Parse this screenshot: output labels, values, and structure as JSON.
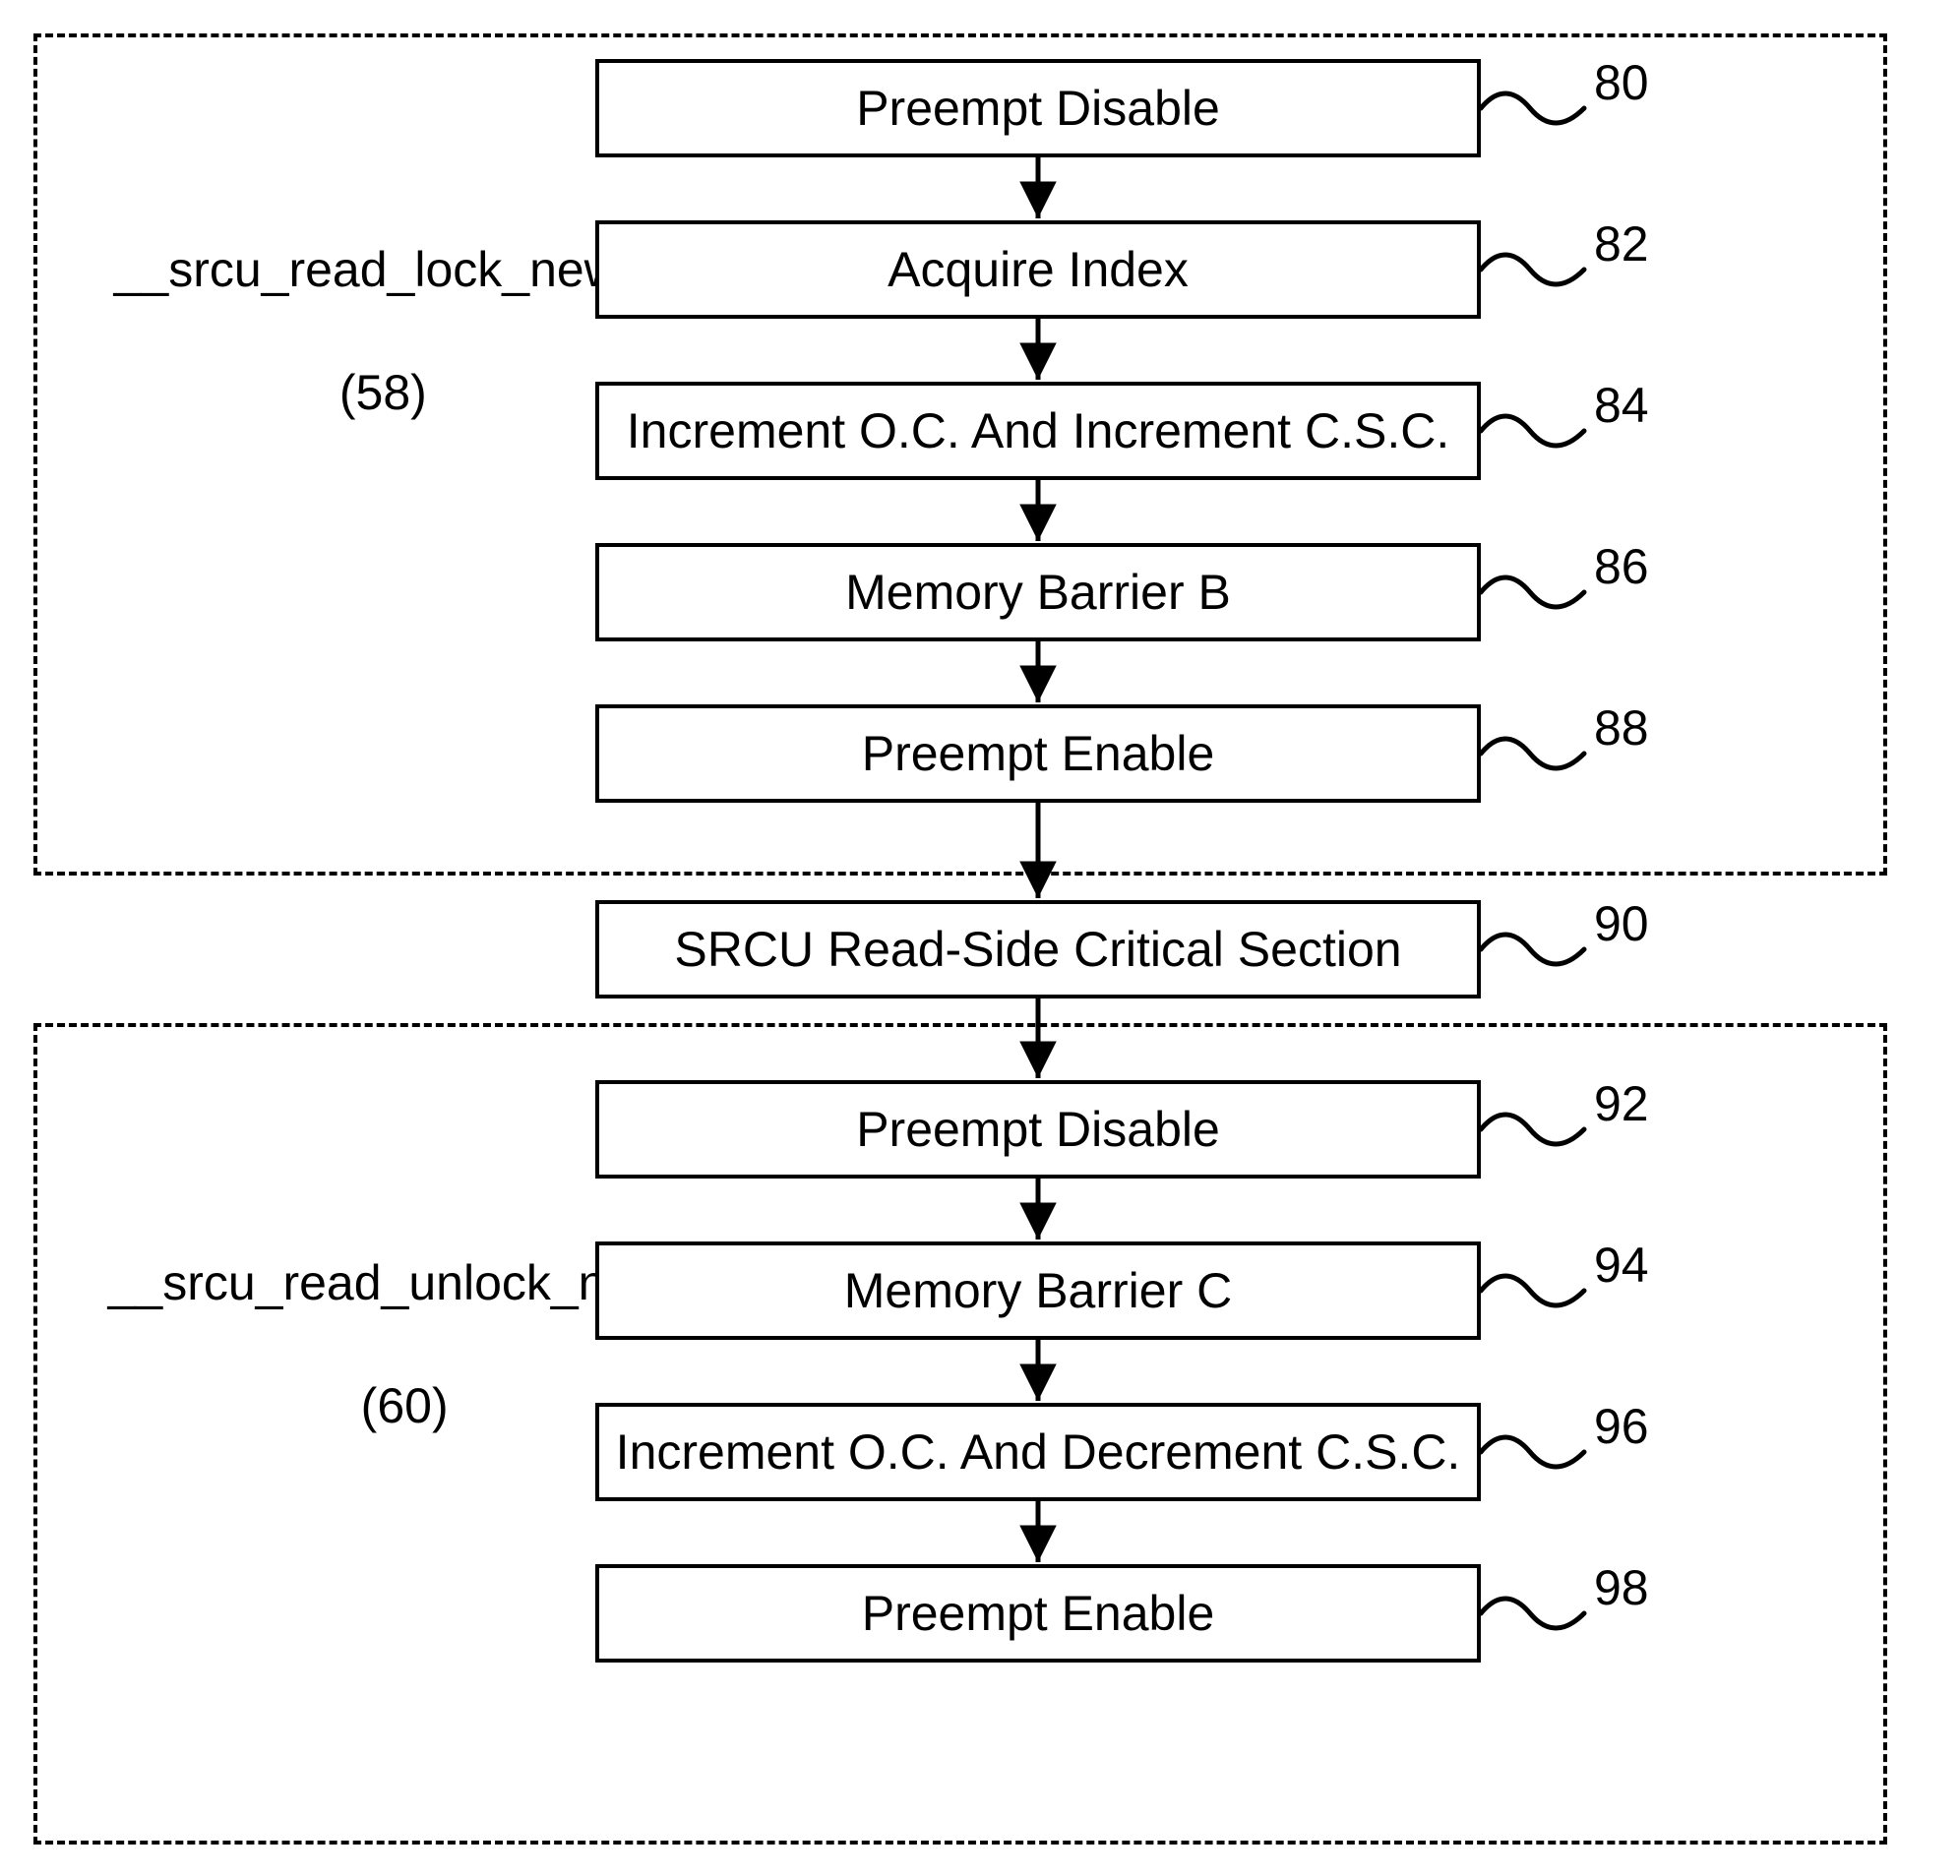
{
  "groups": {
    "lock": {
      "title_line1": "__srcu_read_lock_new()",
      "title_line2": "(58)"
    },
    "unlock": {
      "title_line1": "__srcu_read_unlock_new()",
      "title_line2": "(60)"
    }
  },
  "nodes": {
    "n80": "Preempt Disable",
    "n82": "Acquire Index",
    "n84": "Increment O.C. And Increment C.S.C.",
    "n86": "Memory Barrier B",
    "n88": "Preempt Enable",
    "n90": "SRCU Read-Side Critical Section",
    "n92": "Preempt Disable",
    "n94": "Memory Barrier C",
    "n96": "Increment O.C. And Decrement C.S.C.",
    "n98": "Preempt Enable"
  },
  "refs": {
    "r80": "80",
    "r82": "82",
    "r84": "84",
    "r86": "86",
    "r88": "88",
    "r90": "90",
    "r92": "92",
    "r94": "94",
    "r96": "96",
    "r98": "98"
  }
}
